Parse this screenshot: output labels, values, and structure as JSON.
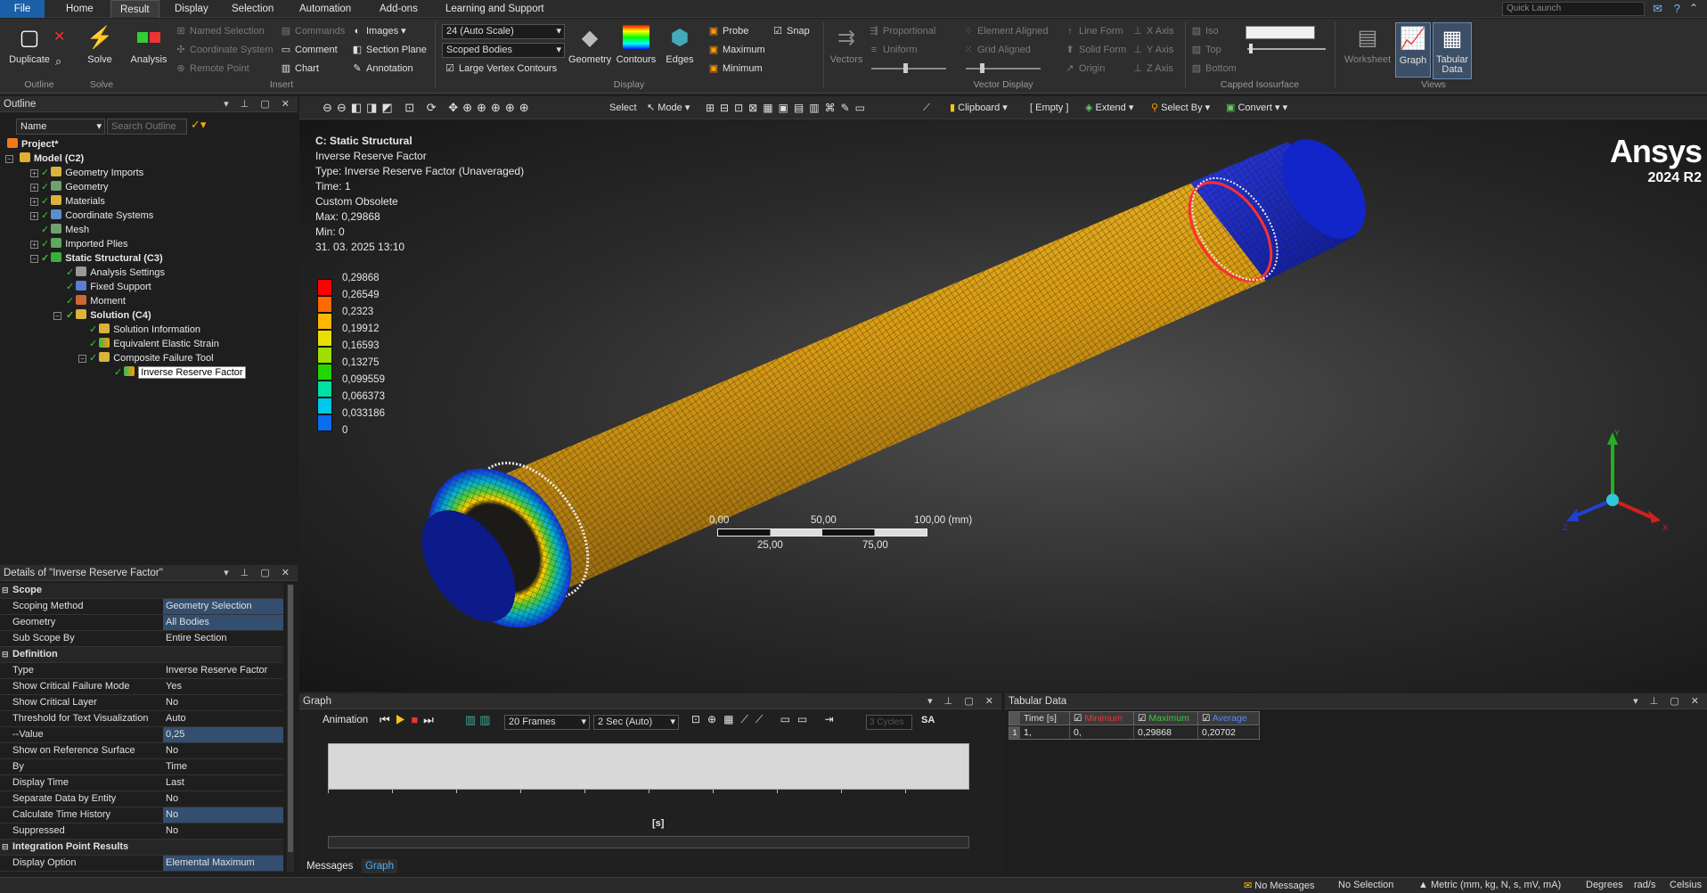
{
  "menu": {
    "file": "File",
    "tabs": [
      "Home",
      "Result",
      "Display",
      "Selection",
      "Automation",
      "Add-ons",
      "Learning and Support"
    ],
    "quick_launch": "Quick Launch"
  },
  "ribbon": {
    "duplicate": "Duplicate",
    "solve": "Solve",
    "analysis": "Analysis",
    "outline_group": "Outline",
    "solve_group": "Solve",
    "insert_group": "Insert",
    "display_group": "Display",
    "vector_group": "Vector Display",
    "capped_group": "Capped Isosurface",
    "views_group": "Views",
    "named_selection": "Named Selection",
    "coordinate_system": "Coordinate System",
    "remote_point": "Remote Point",
    "commands": "Commands",
    "comment": "Comment",
    "chart": "Chart",
    "images": "Images",
    "section_plane": "Section Plane",
    "annotation": "Annotation",
    "scale_combo": "24 (Auto Scale)",
    "scope_combo": "Scoped Bodies",
    "large_vertex": "Large Vertex Contours",
    "geometry": "Geometry",
    "contours": "Contours",
    "edges": "Edges",
    "probe": "Probe",
    "maximum": "Maximum",
    "minimum": "Minimum",
    "snap": "Snap",
    "vectors": "Vectors",
    "proportional": "Proportional",
    "uniform": "Uniform",
    "element_aligned": "Element Aligned",
    "grid_aligned": "Grid Aligned",
    "line_form": "Line Form",
    "solid_form": "Solid Form",
    "origin": "Origin",
    "x_axis": "X Axis",
    "y_axis": "Y Axis",
    "z_axis": "Z Axis",
    "iso": "Iso",
    "top": "Top",
    "bottom": "Bottom",
    "worksheet": "Worksheet",
    "graph": "Graph",
    "tabular_data": "Tabular Data"
  },
  "outline": {
    "title": "Outline",
    "name_col": "Name",
    "search_placeholder": "Search Outline",
    "items": [
      "Project*",
      "Model (C2)",
      "Geometry Imports",
      "Geometry",
      "Materials",
      "Coordinate Systems",
      "Mesh",
      "Imported Plies",
      "Static Structural (C3)",
      "Analysis Settings",
      "Fixed Support",
      "Moment",
      "Solution (C4)",
      "Solution Information",
      "Equivalent Elastic Strain",
      "Composite Failure Tool",
      "Inverse Reserve Factor"
    ]
  },
  "details": {
    "title": "Details of \"Inverse Reserve Factor\"",
    "rows": [
      {
        "k": "Scope",
        "v": "",
        "cat": true
      },
      {
        "k": "Scoping Method",
        "v": "Geometry Selection",
        "blue": true
      },
      {
        "k": "Geometry",
        "v": "All Bodies",
        "blue": true
      },
      {
        "k": "Sub Scope By",
        "v": "Entire Section"
      },
      {
        "k": "Definition",
        "v": "",
        "cat": true
      },
      {
        "k": "Type",
        "v": "Inverse Reserve Factor"
      },
      {
        "k": "Show Critical Failure Mode",
        "v": "Yes"
      },
      {
        "k": "Show Critical Layer",
        "v": "No"
      },
      {
        "k": "Threshold for Text Visualization",
        "v": "Auto"
      },
      {
        "k": "--Value",
        "v": "0,25",
        "blue": true
      },
      {
        "k": "Show on Reference Surface",
        "v": "No"
      },
      {
        "k": "By",
        "v": "Time"
      },
      {
        "k": "Display Time",
        "v": "Last"
      },
      {
        "k": "Separate Data by Entity",
        "v": "No"
      },
      {
        "k": "Calculate Time History",
        "v": "No",
        "blue": true
      },
      {
        "k": "Suppressed",
        "v": "No"
      },
      {
        "k": "Integration Point Results",
        "v": "",
        "cat": true
      },
      {
        "k": "Display Option",
        "v": "Elemental Maximum",
        "blue": true
      }
    ]
  },
  "viewtb": {
    "select": "Select",
    "mode": "Mode",
    "clipboard": "Clipboard",
    "empty": "[ Empty ]",
    "extend": "Extend",
    "select_by": "Select By",
    "convert": "Convert"
  },
  "viewport": {
    "title": "C: Static Structural",
    "result": "Inverse Reserve Factor",
    "type": "Type: Inverse Reserve Factor (Unaveraged)",
    "time": "Time: 1",
    "custom": "Custom Obsolete",
    "max": "Max: 0,29868",
    "min": "Min: 0",
    "date": "31. 03. 2025 13:10",
    "brand": "Ansys",
    "version": "2024 R2",
    "legend": [
      "0,29868",
      "0,26549",
      "0,2323",
      "0,19912",
      "0,16593",
      "0,13275",
      "0,099559",
      "0,066373",
      "0,033186",
      "0"
    ],
    "legend_colors": [
      "#ff0000",
      "#ff6a00",
      "#ffb800",
      "#e8e000",
      "#9ee000",
      "#22d600",
      "#00e0a0",
      "#00c8e8",
      "#0a6cf0",
      "#0000ff"
    ],
    "scale_top": [
      "0,00",
      "50,00",
      "100,00 (mm)"
    ],
    "scale_bottom": [
      "25,00",
      "75,00"
    ],
    "axes": {
      "x": "X",
      "y": "Y",
      "z": "Z"
    }
  },
  "graph": {
    "title": "Graph",
    "animation": "Animation",
    "frames": "20 Frames",
    "duration": "2 Sec (Auto)",
    "cycles": "3 Cycles",
    "sa": "SA",
    "xunit": "[s]",
    "tabs": [
      "Messages",
      "Graph"
    ]
  },
  "tabular": {
    "title": "Tabular Data",
    "headers": [
      "Time [s]",
      "Minimum",
      "Maximum",
      "Average"
    ],
    "rows": [
      [
        "1",
        "1,",
        "0,",
        "0,29868",
        "0,20702"
      ]
    ]
  },
  "status": {
    "messages": "No Messages",
    "selection": "No Selection",
    "units": "Metric (mm, kg, N, s, mV, mA)",
    "angle": "Degrees",
    "rot": "rad/s",
    "temp": "Celsius"
  }
}
